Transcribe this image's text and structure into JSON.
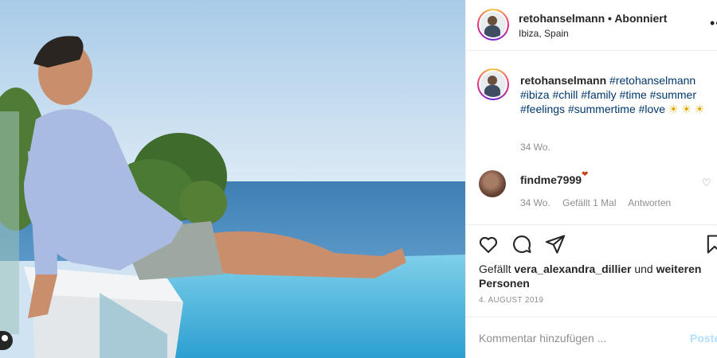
{
  "post": {
    "username": "retohanselmann",
    "separator": "•",
    "follow_status": "Abonniert",
    "location": "Ibiza, Spain"
  },
  "caption": {
    "username": "retohanselmann",
    "tags": [
      "#retohanselmann",
      "#ibiza",
      "#chill",
      "#family",
      "#time",
      "#summer",
      "#feelings",
      "#summertime",
      "#love"
    ],
    "emoji": "☀ ☀ ☀",
    "time": "34 Wo."
  },
  "comment": {
    "username": "findme7999",
    "emoji": "❤",
    "time": "34 Wo.",
    "likes": "Gefällt 1 Mal",
    "reply": "Antworten"
  },
  "likes": {
    "prefix": "Gefällt",
    "user": "vera_alexandra_dillier",
    "middle": "und",
    "others": "weiteren Personen"
  },
  "date": "4. AUGUST 2019",
  "comment_box": {
    "placeholder": "Kommentar hinzufügen ...",
    "post_label": "Posten"
  },
  "icons": {
    "more": "more-options-icon",
    "like": "heart-icon",
    "comment": "comment-bubble-icon",
    "share": "paper-plane-icon",
    "save": "bookmark-icon"
  }
}
